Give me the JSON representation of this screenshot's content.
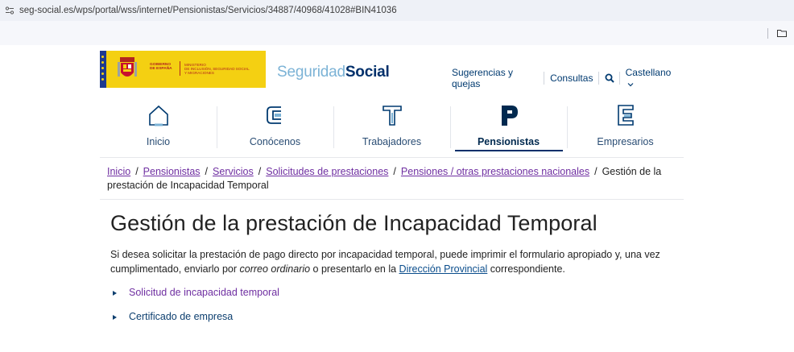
{
  "browser": {
    "url": "seg-social.es/wps/portal/wss/internet/Pensionistas/Servicios/34887/40968/41028#BIN41036"
  },
  "header": {
    "gov_logo": {
      "line1": "GOBIERNO",
      "line2": "DE ESPAÑA",
      "ministry1": "MINISTERIO",
      "ministry2": "DE INCLUSIÓN, SEGURIDAD SOCIAL",
      "ministry3": "Y MIGRACIONES"
    },
    "brand_light": "Seguridad",
    "brand_bold": "Social",
    "links": {
      "sugerencias": "Sugerencias y quejas",
      "consultas": "Consultas",
      "language": "Castellano"
    }
  },
  "mainnav": {
    "items": [
      {
        "label": "Inicio",
        "icon": "house-icon"
      },
      {
        "label": "Conócenos",
        "icon": "c-letter-icon"
      },
      {
        "label": "Trabajadores",
        "icon": "t-letter-icon"
      },
      {
        "label": "Pensionistas",
        "icon": "p-letter-icon",
        "active": true
      },
      {
        "label": "Empresarios",
        "icon": "e-letter-icon"
      }
    ]
  },
  "breadcrumb": {
    "items": [
      "Inicio",
      "Pensionistas",
      "Servicios",
      "Solicitudes de prestaciones",
      "Pensiones / otras prestaciones nacionales"
    ],
    "current": "Gestión de la prestación de Incapacidad Temporal",
    "separator": "/"
  },
  "page": {
    "title": "Gestión de la prestación de Incapacidad Temporal",
    "intro_part1": "Si desea solicitar la prestación de pago directo por incapacidad temporal, puede imprimir el formulario apropiado y, una vez cumplimentado, enviarlo por ",
    "intro_em": "correo ordinario",
    "intro_part2": " o presentarlo en la ",
    "intro_link": "Dirección Provincial",
    "intro_part3": " correspondiente.",
    "documents": [
      "Solicitud de incapacidad temporal",
      "Certificado de empresa"
    ]
  },
  "colors": {
    "brand_navy": "#00306b",
    "link_visited": "#6f2fa1",
    "link": "#0a4d8c",
    "gov_yellow": "#f4d012"
  }
}
